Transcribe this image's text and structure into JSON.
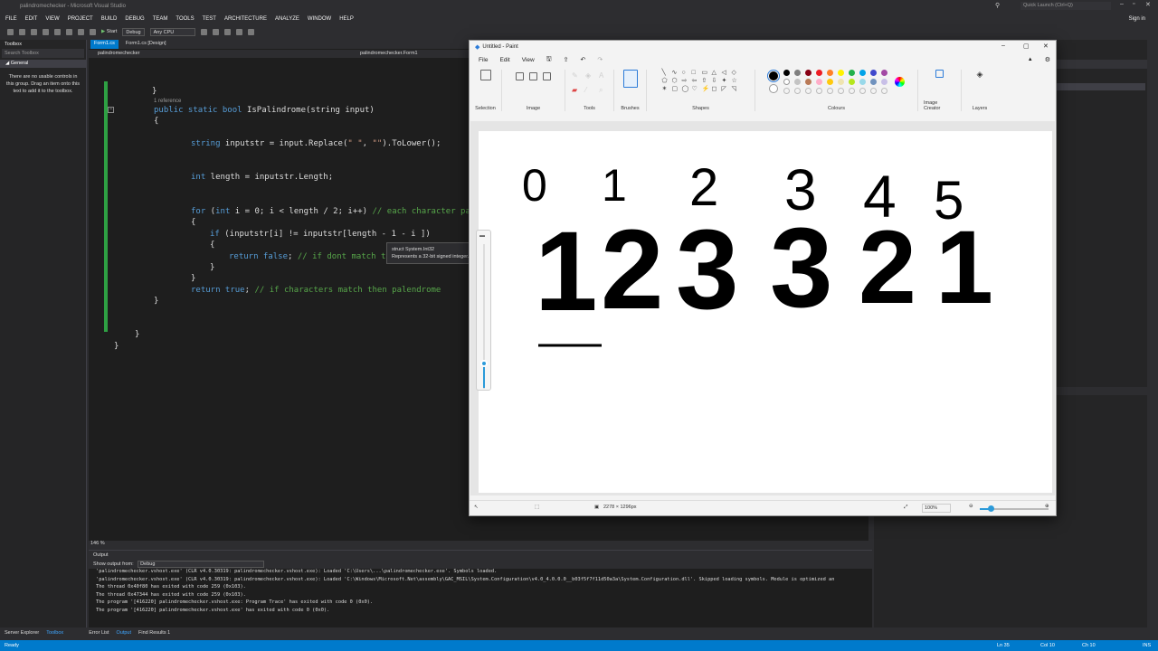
{
  "vs": {
    "title": "palindromechecker - Microsoft Visual Studio",
    "quick_launch": "Quick Launch (Ctrl+Q)",
    "sign_in": "Sign in",
    "menu": [
      "FILE",
      "EDIT",
      "VIEW",
      "PROJECT",
      "BUILD",
      "DEBUG",
      "TEAM",
      "TOOLS",
      "TEST",
      "ARCHITECTURE",
      "ANALYZE",
      "WINDOW",
      "HELP"
    ],
    "toolbar": {
      "start": "Start",
      "config": "Debug",
      "platform": "Any CPU"
    },
    "toolbox": {
      "title": "Toolbox",
      "search": "Search Toolbox",
      "group": "General",
      "message": "There are no usable controls in this group. Drag an item onto this text to add it to the toolbox."
    },
    "tabs": [
      "Form1.cs",
      "Form1.cs [Design]"
    ],
    "nav_left": "palindromechecker",
    "nav_right": "palindromechecker.Form1",
    "code": {
      "brace_close": "}",
      "ref": "1 reference",
      "sig_kw": "public static bool",
      "sig_rest": " IsPalindrome(string input)",
      "open": "{",
      "l_replace_kw": "string",
      "l_replace_a": " inputstr = input.Replace(",
      "l_replace_s1": "\" \"",
      "l_replace_b": ", ",
      "l_replace_s2": "\"\"",
      "l_replace_c": ").ToLower();",
      "l_len_kw": "int",
      "l_len_rest": " length = inputstr.Length;",
      "l_for_kw": "for",
      "l_for_a": " (",
      "l_for_kw2": "int",
      "l_for_b": " i = 0; i < length / 2; i++) ",
      "l_for_cm": "// each character pair",
      "l_for_open": "{",
      "l_if_kw": "if",
      "l_if_rest": " (inputstr[i] != inputstr[length - 1 - i ])",
      "l_if_open": "{",
      "l_ret_kw": "return false",
      "l_ret_a": "; ",
      "l_ret_cm": "// if dont match th",
      "l_if_close": "}",
      "l_for_close": "}",
      "l_rt_kw": "return true",
      "l_rt_a": "; ",
      "l_rt_cm": "// if characters match then palendrome",
      "l_m_close": "}",
      "l_c_close": "}",
      "l_n_close": "}"
    },
    "tooltip": {
      "line1": "struct System.Int32",
      "line2": "Represents a 32-bit signed integer."
    },
    "zoom": "146 %",
    "output": {
      "title": "Output",
      "from_label": "Show output from:",
      "from_value": "Debug",
      "lines": [
        "'palindromechecker.vshost.exe' (CLR v4.0.30319: palindromechecker.vshost.exe): Loaded 'C:\\Users\\...\\palindromechecker.exe'. Symbols loaded.",
        "'palindromechecker.vshost.exe' (CLR v4.0.30319: palindromechecker.vshost.exe): Loaded 'C:\\Windows\\Microsoft.Net\\assembly\\GAC_MSIL\\System.Configuration\\v4.0_4.0.0.0__b03f5f7f11d50a3a\\System.Configuration.dll'. Skipped loading symbols. Module is optimized an",
        "The thread 0x40f80 has exited with code 259 (0x103).",
        "The thread 0x47344 has exited with code 259 (0x103).",
        "The program '[416220] palindromechecker.vshost.exe: Program Trace' has exited with code 0 (0x0).",
        "The program '[416220] palindromechecker.vshost.exe' has exited with code 0 (0x0)."
      ]
    },
    "bottom_tabs_left": [
      "Server Explorer",
      "Toolbox"
    ],
    "bottom_tabs": [
      "Error List",
      "Output",
      "Find Results 1"
    ],
    "status": {
      "ready": "Ready",
      "ln": "Ln 35",
      "col": "Col 10",
      "ch": "Ch 10",
      "ins": "INS"
    }
  },
  "paint": {
    "title": "Untitled - Paint",
    "menu": [
      "File",
      "Edit",
      "View"
    ],
    "groups": [
      "Selection",
      "Image",
      "Tools",
      "Brushes",
      "Shapes",
      "Colours",
      "Image Creator",
      "Layers"
    ],
    "size": "2278 × 1296px",
    "zoom": "100%",
    "canvas": {
      "indices": [
        "0",
        "1",
        "2",
        "3",
        "4",
        "5"
      ],
      "digits": [
        "1",
        "2",
        "3",
        "3",
        "2",
        "1"
      ]
    },
    "colors": {
      "row1": [
        "#000000",
        "#7f7f7f",
        "#880015",
        "#ed1c24",
        "#ff7f27",
        "#fff200",
        "#22b14c",
        "#00a2e8",
        "#3f48cc",
        "#a349a4"
      ],
      "row2": [
        "#ffffff",
        "#c3c3c3",
        "#b97a57",
        "#ffaec9",
        "#ffc90e",
        "#efe4b0",
        "#b5e61d",
        "#99d9ea",
        "#7092be",
        "#c8bfe7"
      ]
    }
  }
}
